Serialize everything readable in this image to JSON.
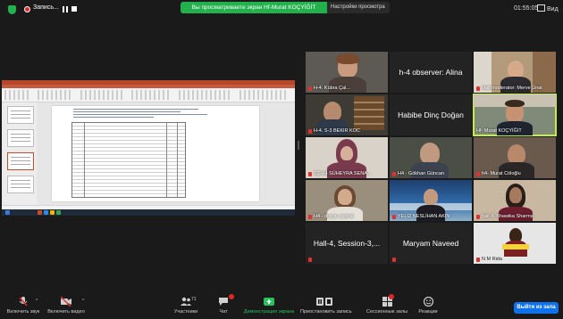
{
  "topbar": {
    "recording_label": "Запись...",
    "share_banner": "Вы просматриваете экран Hf-Murat KOÇYİĞİT",
    "share_settings": "Настройки просмотра",
    "timer": "01:55:05",
    "view_label": "Вид"
  },
  "participants": [
    {
      "name": "H-4. Kübra Çal...",
      "video": true
    },
    {
      "name": "h-4 observer: Alina",
      "video": false
    },
    {
      "name": "Hall-moderator: Merve Ünal",
      "video": true
    },
    {
      "name": "H-4. S-3 BEKIR KOC",
      "video": true
    },
    {
      "name": "Habibe Dinç Doğan",
      "video": false
    },
    {
      "name": "Hf- Murat KOÇYİĞİT",
      "video": true,
      "speaking": true
    },
    {
      "name": "S3-H4 SÜHEYRA SENA...",
      "video": true
    },
    {
      "name": "H4 - Gökhan Güncan",
      "video": true
    },
    {
      "name": "h4- Murat Cöloğlu",
      "video": true
    },
    {
      "name": "H4 - duygu yaprak",
      "video": true
    },
    {
      "name": "YELİZ NESLİHAN AKIN",
      "video": true
    },
    {
      "name": "hall 4. Bhawika Sharma",
      "video": true
    },
    {
      "name": "Hall-4, Session-3,...",
      "video": false
    },
    {
      "name": "Maryam Naveed",
      "video": false
    },
    {
      "name": "N M Rida",
      "video": true
    }
  ],
  "toolbar": {
    "mic_label": "Включить звук",
    "video_label": "Включить видео",
    "participants_label": "Участники",
    "participants_count": "71",
    "chat_label": "Чат",
    "share_label": "Демонстрация экрана",
    "record_label": "Приостановить запись",
    "breakout_label": "Сессионные залы",
    "reactions_label": "Реакции",
    "leave_label": "Выйти из зала"
  },
  "colors": {
    "share_green": "#23b14d",
    "speaking_outline": "#c8ee3c",
    "leave_blue": "#0e72ed",
    "muted_red": "#e03030"
  }
}
